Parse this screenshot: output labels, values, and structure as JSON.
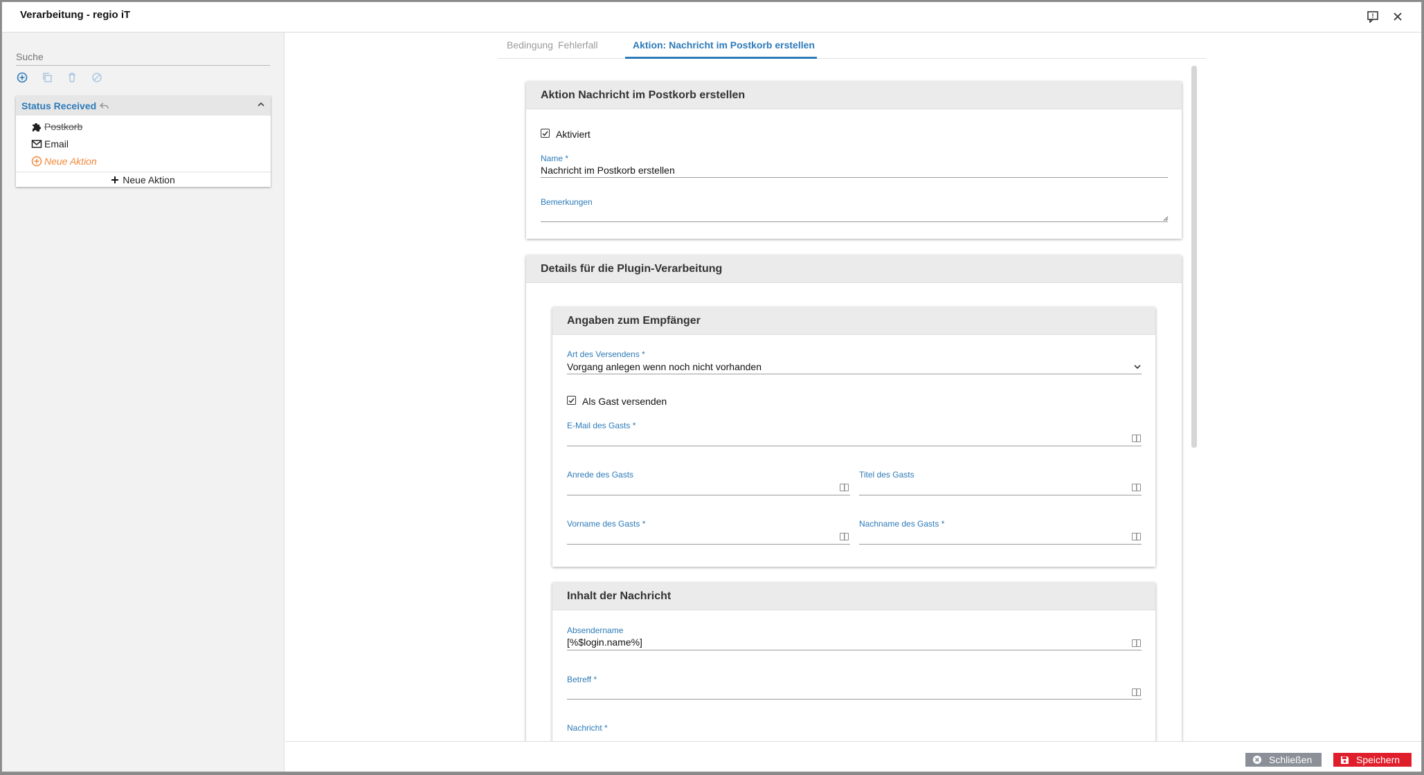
{
  "window": {
    "title": "Verarbeitung - regio iT"
  },
  "sidebar": {
    "search_placeholder": "Suche",
    "panel_title": "Status Received",
    "items": [
      {
        "label": "Postkorb",
        "icon": "puzzle-icon",
        "struck": true
      },
      {
        "label": "Email",
        "icon": "envelope-icon"
      },
      {
        "label": "Neue Aktion",
        "icon": "plus-circle-icon"
      }
    ],
    "add_action_label": "Neue Aktion"
  },
  "tabs": [
    {
      "label": "Bedingung"
    },
    {
      "label": "Fehlerfall"
    },
    {
      "label": "Aktion: Nachricht im Postkorb erstellen",
      "active": true
    }
  ],
  "action_card": {
    "title": "Aktion Nachricht im Postkorb erstellen",
    "activated_label": "Aktiviert",
    "activated": true,
    "name_label": "Name *",
    "name_value": "Nachricht im Postkorb erstellen",
    "remarks_label": "Bemerkungen",
    "remarks_value": ""
  },
  "plugin_card": {
    "title": "Details für die Plugin-Verarbeitung",
    "recipient": {
      "title": "Angaben zum Empfänger",
      "send_type_label": "Art des Versendens *",
      "send_type_value": "Vorgang anlegen wenn noch nicht vorhanden",
      "as_guest_label": "Als Gast versenden",
      "as_guest": true,
      "email_label": "E-Mail des Gasts *",
      "salutation_label": "Anrede des Gasts",
      "title_label": "Titel des Gasts",
      "firstname_label": "Vorname des Gasts *",
      "lastname_label": "Nachname des Gasts *"
    },
    "content": {
      "title": "Inhalt der Nachricht",
      "sender_label": "Absendername",
      "sender_value": "[%$login.name%]",
      "subject_label": "Betreff *",
      "message_label": "Nachricht *"
    }
  },
  "footer": {
    "close_label": "Schließen",
    "save_label": "Speichern"
  },
  "colors": {
    "accent": "#2c7ab8",
    "danger": "#e01e2b",
    "neutral_button": "#8a8f98",
    "new_action": "#f0883a"
  }
}
